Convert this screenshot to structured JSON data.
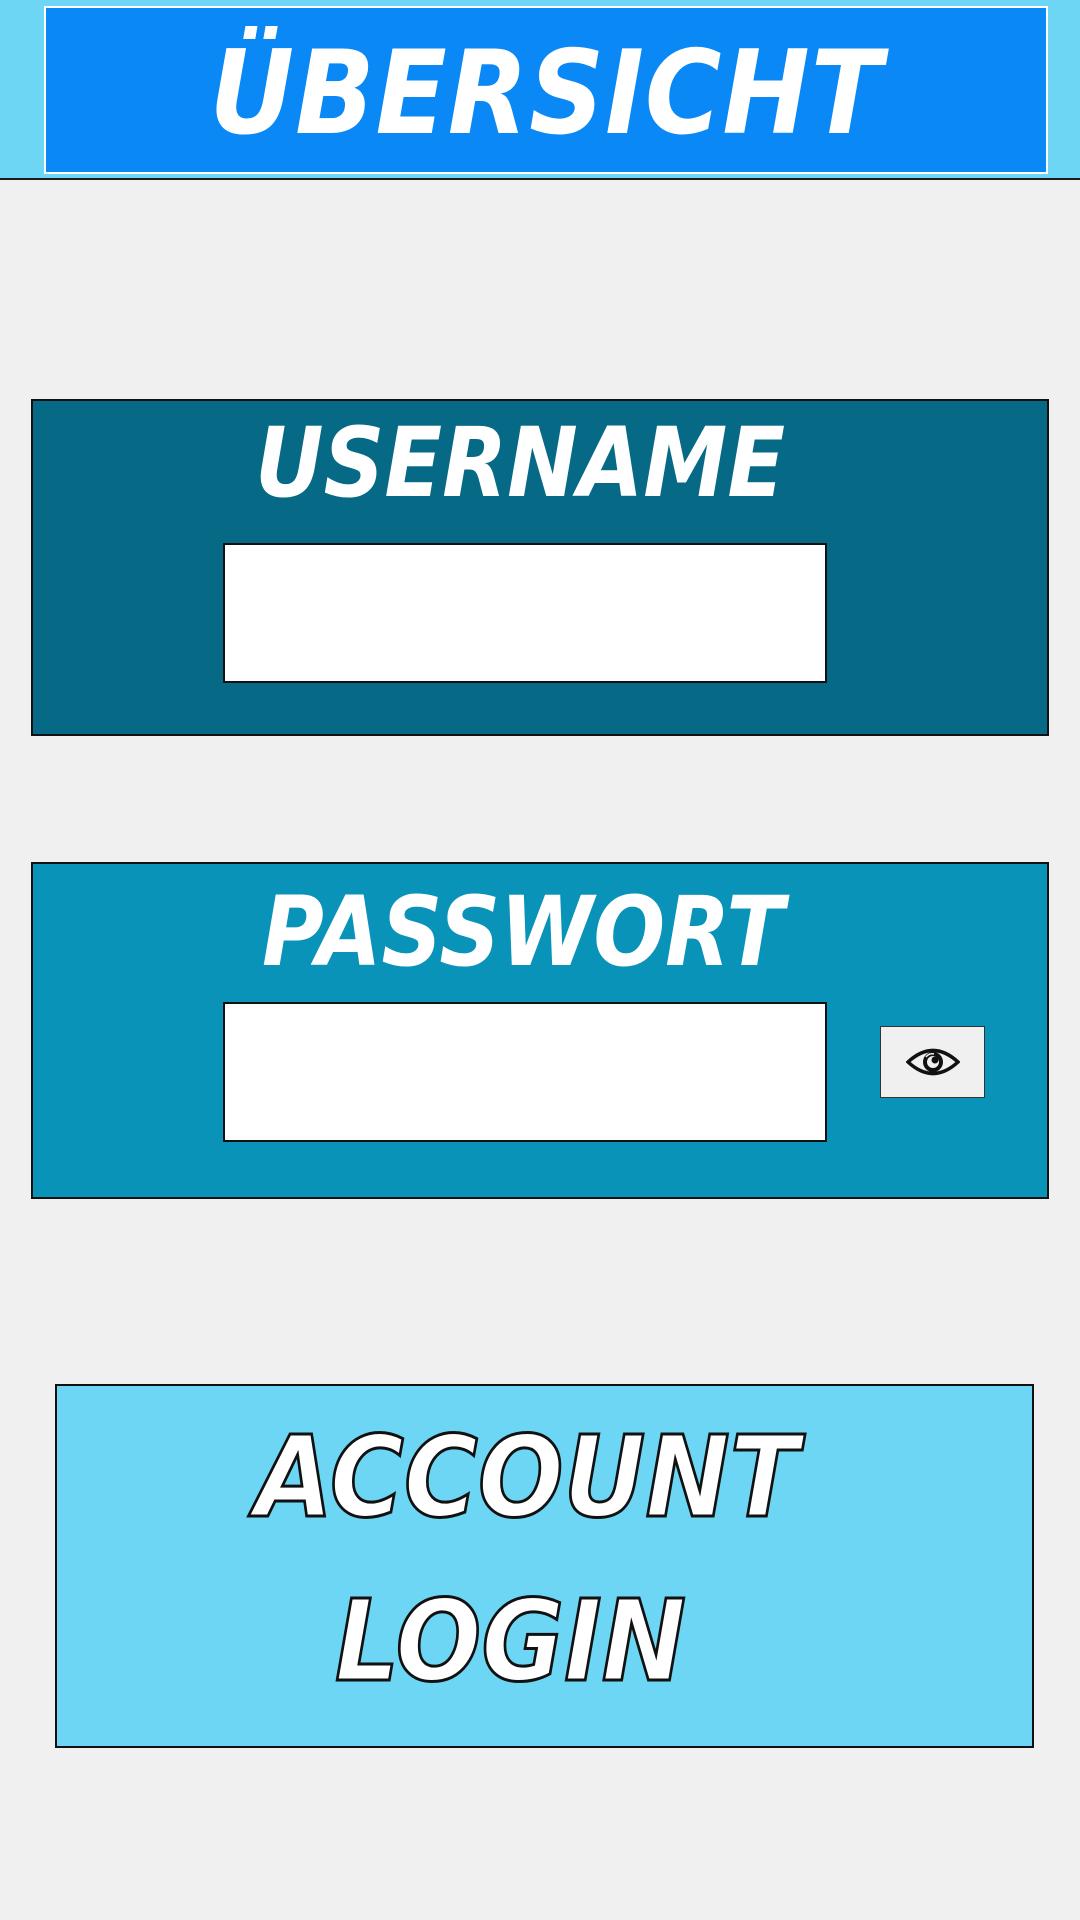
{
  "header": {
    "title": "ÜBERSICHT"
  },
  "username": {
    "label": "USERNAME",
    "value": ""
  },
  "password": {
    "label": "PASSWORT",
    "value": "",
    "toggle_icon": "eye-icon"
  },
  "login_button": {
    "line1": "ACCOUNT",
    "line2": "LOGIN"
  },
  "colors": {
    "background": "#f0f0f0",
    "header_band": "#6dd6f4",
    "header_title_box": "#0a88f5",
    "username_panel": "#066a87",
    "password_panel": "#0a93b8",
    "login_button": "#6dd6f4"
  }
}
